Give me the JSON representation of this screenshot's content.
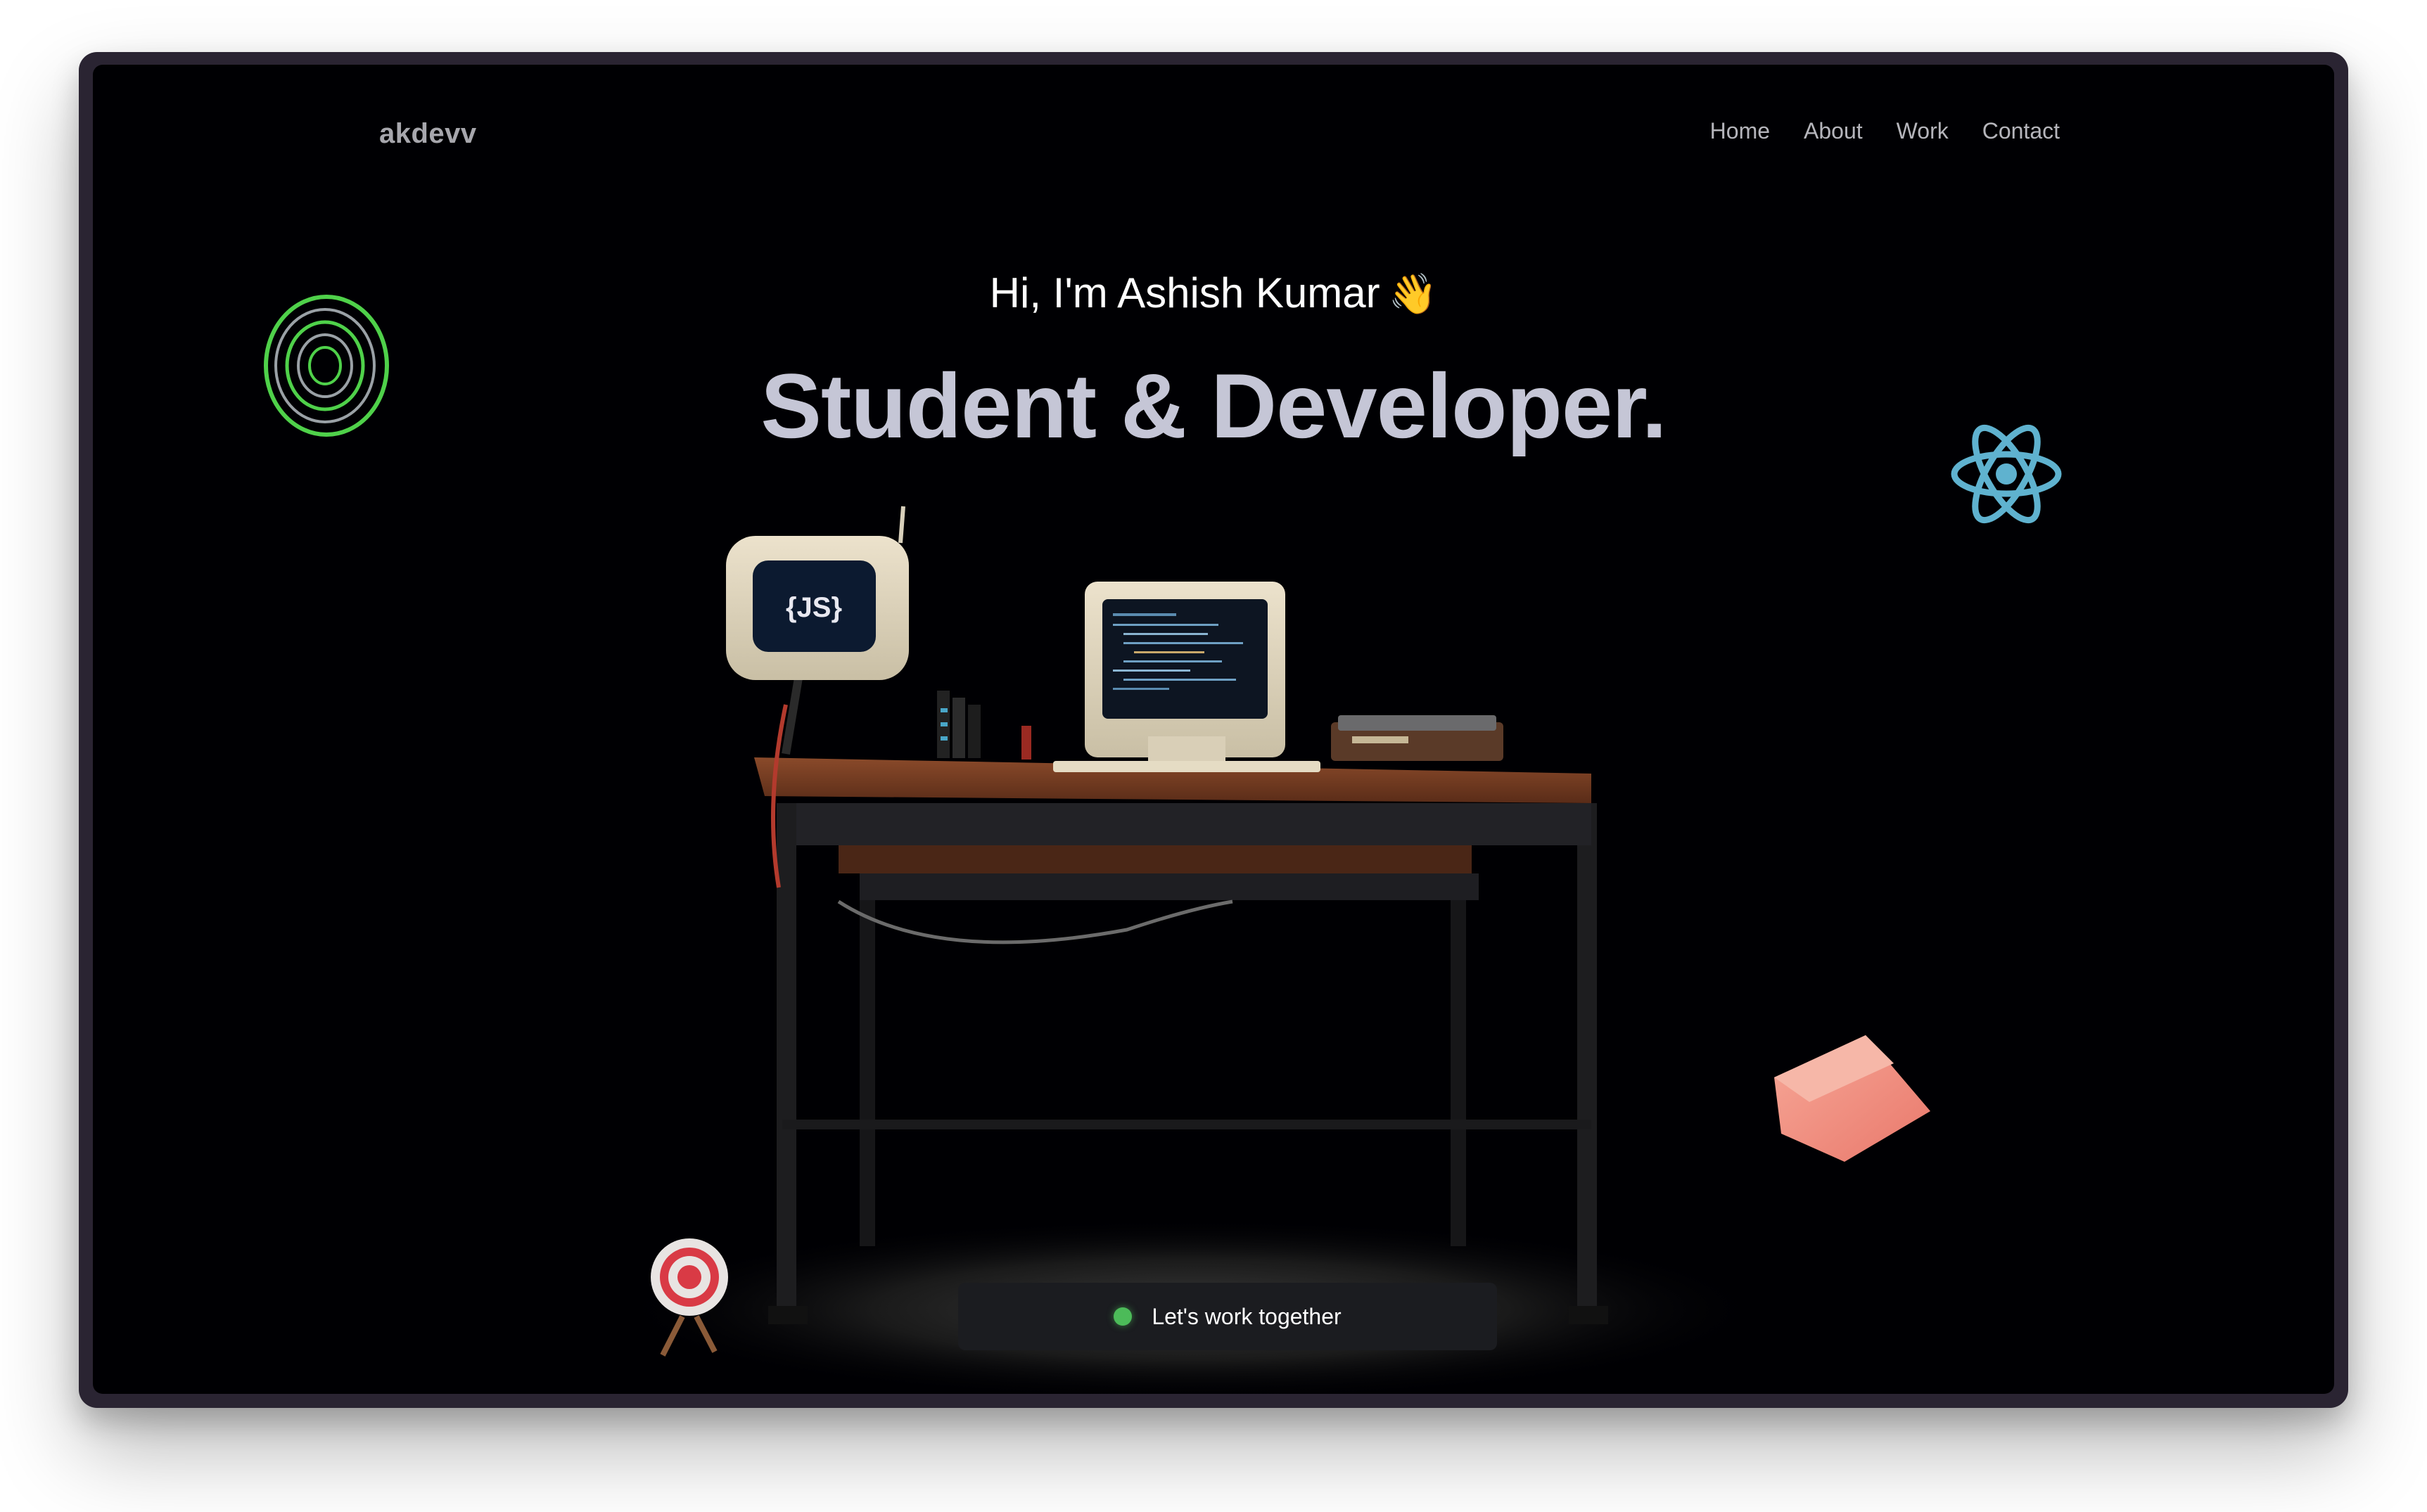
{
  "nav": {
    "logo": "akdevv",
    "links": [
      "Home",
      "About",
      "Work",
      "Contact"
    ]
  },
  "hero": {
    "greeting": "Hi, I'm Ashish Kumar",
    "title": "Student & Developer."
  },
  "cta": {
    "label": "Let's work together",
    "status_color": "#4cbb59"
  },
  "colors": {
    "background": "#000003",
    "headline": "#c5c6d6",
    "ring_green": "#4fd14a",
    "react_blue": "#5fb2cf",
    "cube_pink": "#f2917f",
    "target_red": "#d93a45"
  },
  "icons": {
    "greeting_emoji": "waving-hand-icon",
    "floating": [
      "green-rings-icon",
      "react-logo-icon",
      "pink-cube-icon",
      "target-icon"
    ]
  },
  "desk_objects": {
    "small_monitor_label": "{JS}"
  }
}
